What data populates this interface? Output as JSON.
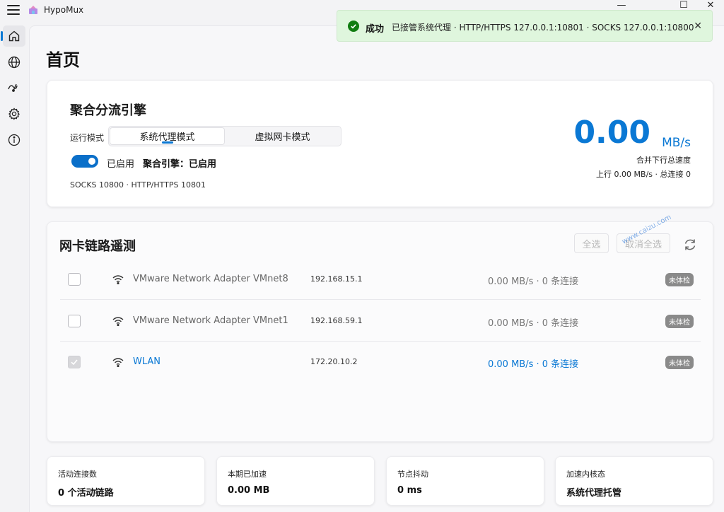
{
  "app": {
    "title": "HypoMux"
  },
  "window": {
    "minimize": "—",
    "maximize": "☐",
    "close": "✕"
  },
  "rail": [
    {
      "name": "home-icon",
      "active": true
    },
    {
      "name": "globe-icon",
      "active": false
    },
    {
      "name": "speed-icon",
      "active": false
    },
    {
      "name": "gear-icon",
      "active": false
    },
    {
      "name": "info-icon",
      "active": false
    }
  ],
  "page": {
    "title": "首页"
  },
  "engine": {
    "title": "聚合分流引擎",
    "mode_label": "运行模式",
    "modes": [
      "系统代理模式",
      "虚拟网卡模式"
    ],
    "active_mode": 0,
    "toggle_label": "已启用",
    "status": "聚合引擎：已启用",
    "ports": "SOCKS 10800 · HTTP/HTTPS 10801",
    "speed": "0.00",
    "speed_unit": "MB/s",
    "speed_label": "合并下行总速度",
    "speed_detail": "上行 0.00 MB/s · 总连接 0"
  },
  "nic": {
    "title": "网卡链路遥测",
    "select_all": "全选",
    "deselect_all": "取消全选",
    "rows": [
      {
        "name": "VMware Network Adapter VMnet8",
        "ip": "192.168.15.1",
        "stat": "0.00 MB/s · 0 条连接",
        "badge": "未体检",
        "checked": false
      },
      {
        "name": "VMware Network Adapter VMnet1",
        "ip": "192.168.59.1",
        "stat": "0.00 MB/s · 0 条连接",
        "badge": "未体检",
        "checked": false
      },
      {
        "name": "WLAN",
        "ip": "172.20.10.2",
        "stat": "0.00 MB/s · 0 条连接",
        "badge": "未体检",
        "checked": true
      }
    ]
  },
  "stats": [
    {
      "label": "活动连接数",
      "value": "0 个活动链路"
    },
    {
      "label": "本期已加速",
      "value": "0.00 MB"
    },
    {
      "label": "节点抖动",
      "value": "0 ms"
    },
    {
      "label": "加速内核态",
      "value": "系统代理托管"
    }
  ],
  "toast": {
    "title": "成功",
    "message": "已接管系统代理 · HTTP/HTTPS 127.0.0.1:10801 · SOCKS 127.0.0.1:10800"
  },
  "watermark": "www.caizu.com",
  "colors": {
    "accent": "#0a78d4",
    "success": "#107c10",
    "toast_bg": "#dff6dd"
  }
}
